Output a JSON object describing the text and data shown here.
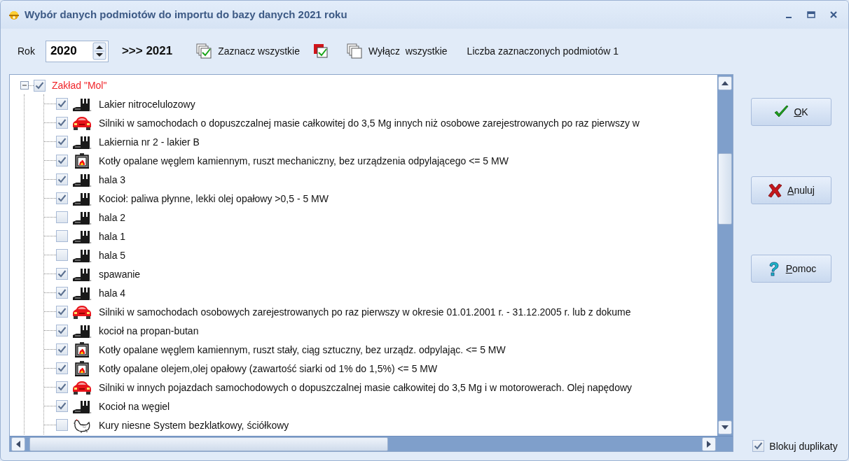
{
  "window": {
    "title": "Wybór danych podmiotów do importu do bazy danych 2021 roku"
  },
  "toolbar": {
    "year_label": "Rok",
    "year": "2020",
    "target": ">>> 2021",
    "select_all": "Zaznacz wszystkie",
    "deselect_all": "Wyłącz  wszystkie",
    "count_label": "Liczba zaznaczonych podmiotów 1"
  },
  "tree": {
    "root": {
      "label": "Zakład \"Mol\"",
      "checked": true,
      "expanded": true,
      "children": [
        {
          "label": "Lakier nitrocelulozowy",
          "kind": "factory",
          "checked": true
        },
        {
          "label": "Silniki w samochodach o dopuszczalnej masie całkowitej do 3,5 Mg innych niż osobowe zarejestrowanych po raz pierwszy w",
          "kind": "car",
          "checked": true
        },
        {
          "label": "Lakiernia nr 2 - lakier B",
          "kind": "factory",
          "checked": true
        },
        {
          "label": "Kotły opalane węglem kamiennym, ruszt mechaniczny, bez urządzenia odpylającego <= 5 MW",
          "kind": "furnace",
          "checked": true
        },
        {
          "label": "hala 3",
          "kind": "factory",
          "checked": true
        },
        {
          "label": "Kocioł: paliwa płynne, lekki olej opałowy >0,5 - 5 MW",
          "kind": "factory",
          "checked": true
        },
        {
          "label": "hala 2",
          "kind": "factory",
          "checked": false
        },
        {
          "label": "hala 1",
          "kind": "factory",
          "checked": false
        },
        {
          "label": "hala 5",
          "kind": "factory",
          "checked": false
        },
        {
          "label": "spawanie",
          "kind": "factory",
          "checked": true
        },
        {
          "label": "hala 4",
          "kind": "factory",
          "checked": true
        },
        {
          "label": "Silniki w samochodach osobowych zarejestrowanych po raz pierwszy w okresie 01.01.2001 r. - 31.12.2005 r. lub z dokume",
          "kind": "car",
          "checked": true
        },
        {
          "label": "kocioł na propan-butan",
          "kind": "factory",
          "checked": true
        },
        {
          "label": "Kotły opalane węglem kamiennym, ruszt stały, ciąg sztuczny, bez urządz. odpylając. <= 5 MW",
          "kind": "furnace",
          "checked": true
        },
        {
          "label": "Kotły opalane olejem,olej opałowy (zawartość siarki od 1% do 1,5%) <= 5 MW",
          "kind": "furnace",
          "checked": true
        },
        {
          "label": "Silniki w innych pojazdach samochodowych o dopuszczalnej masie całkowitej do 3,5 Mg i w motorowerach. Olej napędowy",
          "kind": "car",
          "checked": true
        },
        {
          "label": "Kocioł na węgiel",
          "kind": "factory",
          "checked": true
        },
        {
          "label": "Kury niesne System bezklatkowy, ściółkowy",
          "kind": "hen",
          "checked": false
        }
      ]
    }
  },
  "buttons": [
    {
      "label": "OK",
      "kind": "ok"
    },
    {
      "label": "Anuluj",
      "kind": "cancel"
    },
    {
      "label": "Pomoc",
      "kind": "help"
    }
  ],
  "block_duplicates": {
    "label": "Blokuj duplikaty",
    "checked": true
  }
}
